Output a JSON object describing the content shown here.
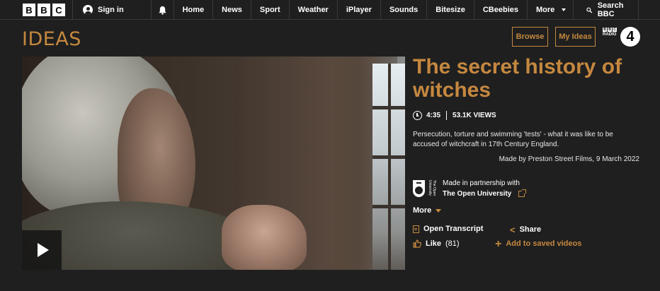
{
  "nav": {
    "logo_letters": [
      "B",
      "B",
      "C"
    ],
    "signin": "Sign in",
    "links": [
      "Home",
      "News",
      "Sport",
      "Weather",
      "iPlayer",
      "Sounds",
      "Bitesize",
      "CBeebies"
    ],
    "more": "More",
    "search": "Search BBC"
  },
  "header": {
    "brand": "IDEAS",
    "browse": "Browse",
    "my_ideas": "My Ideas",
    "radio_badge": "4"
  },
  "video": {
    "title": "The secret history of witches",
    "duration": "4:35",
    "views": "53.1K VIEWS",
    "description": "Persecution, torture and swimming 'tests' - what it was like to be accused of witchcraft in 17th Century England.",
    "made_by": "Made by Preston Street Films, 9 March 2022"
  },
  "partner": {
    "vertical": "The Open University",
    "label": "Made in partnership with",
    "name": "The Open University"
  },
  "more_label": "More",
  "actions": {
    "transcript": "Open Transcript",
    "share": "Share",
    "like": "Like",
    "like_count": "(81)",
    "save": "Add to saved videos"
  },
  "colors": {
    "accent": "#c5883f",
    "background": "#1f1f1f"
  }
}
